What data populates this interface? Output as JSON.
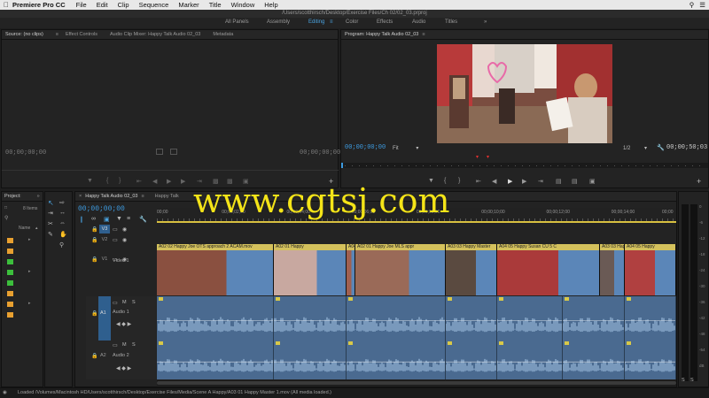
{
  "menubar": {
    "apple_icon": "apple-icon",
    "app_name": "Premiere Pro CC",
    "items": [
      "File",
      "Edit",
      "Clip",
      "Sequence",
      "Marker",
      "Title",
      "Window",
      "Help"
    ]
  },
  "window": {
    "path": "/Users/scotthirsch/Desktop/Exercise Files/Ch 02/02_03.prproj"
  },
  "workspaces": {
    "items": [
      "All Panels",
      "Assembly",
      "Editing",
      "Color",
      "Effects",
      "Audio",
      "Titles"
    ],
    "active": "Editing",
    "more": "»"
  },
  "source_panel": {
    "tabs": [
      "Source: (no clips)",
      "Effect Controls",
      "Audio Clip Mixer: Happy Talk Audio 02_03",
      "Metadata"
    ],
    "timecode_left": "00;00;00;00",
    "timecode_right": "00;00;00;00"
  },
  "program_panel": {
    "title": "Program: Happy Talk Audio 02_03",
    "timecode": "00;00;00;00",
    "fit": "Fit",
    "resolution": "1/2",
    "duration": "00;00;50;03"
  },
  "project_panel": {
    "title": "Project:",
    "items_count": "8 Items",
    "name_col": "Name",
    "swatch_colors": [
      "#e8a030",
      "#e8a030",
      "#3cbf3c",
      "#3cbf3c",
      "#3cbf3c",
      "#e8a030",
      "#e8a030",
      "#e8a030"
    ]
  },
  "timeline": {
    "tabs": [
      "Happy Talk Audio 02_03",
      "Happy Talk"
    ],
    "timecode": "00;00;00;00",
    "ruler": [
      "00;00",
      "00;00;02;00",
      "00;00;04;00",
      "00;00;06;00",
      "00;00;08;00",
      "00;00;10;00",
      "00;00;12;00",
      "00;00;14;00",
      "00;00"
    ],
    "tracks": {
      "v3": "V3",
      "v2": "V2",
      "v1": "V1",
      "v1_name": "Video 1",
      "a1": "A1",
      "a1_name": "Audio 1",
      "a2": "A2",
      "a2_name": "Audio 2"
    },
    "video_clips": [
      "A02 02 Happy Joe OTS approach 2 ACAM.mov",
      "A02 01 Happy",
      "A04 05 H",
      "A02 01 Happy Joe MLS appr",
      "A03 03 Happy Master",
      "A04 05 Happy Susan CU 5 C",
      "A03 03 Happy",
      "A04 05 Happy"
    ],
    "meter_labels": [
      "0",
      "-6",
      "-12",
      "-18",
      "-24",
      "-30",
      "-36",
      "-42",
      "-48",
      "-54",
      "dB"
    ],
    "meter_solo": [
      "S",
      "S"
    ]
  },
  "watermark": "www.cgtsj.com",
  "status": "Loaded /Volumes/Macintosh HD/Users/scotthirsch/Desktop/Exercise Files/Media/Scene A Happy/A03 01 Happy Master 1.mov (All media loaded.)"
}
